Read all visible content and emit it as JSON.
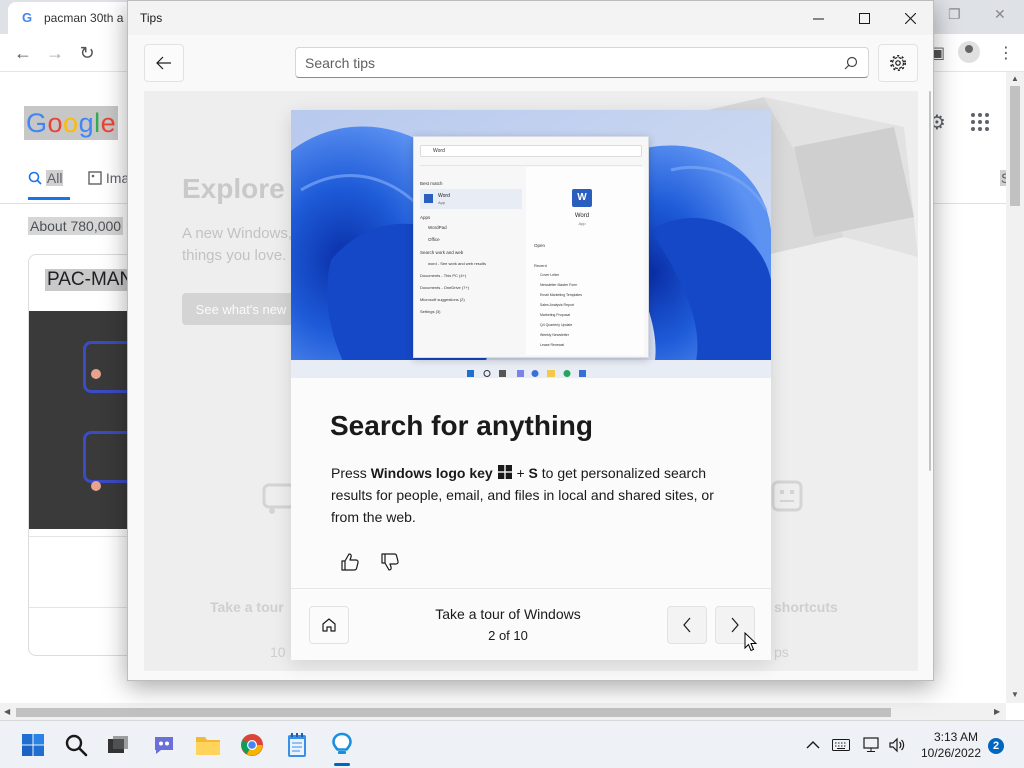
{
  "browser": {
    "tab_title": "pacman 30th an",
    "google_logo": [
      "G",
      "o",
      "o",
      "g",
      "l",
      "e"
    ],
    "search_tabs": [
      {
        "label": "All",
        "icon": "search-icon",
        "active": true
      },
      {
        "label": "Ima",
        "icon": "image-icon",
        "active": false
      }
    ],
    "right_tab_partial": "S",
    "result_stats": "About 780,000",
    "knowledge_card_title": "PAC-MAN"
  },
  "tips": {
    "window_title": "Tips",
    "search_placeholder": "Search tips",
    "background": {
      "heading": "Explore W",
      "subtext": "A new Windows, things you love.",
      "button": "See what's new",
      "tile_left": "Take a tour",
      "tile_right": "shortcuts",
      "tile_left_sub": "10",
      "tile_right_sub": "ps"
    },
    "card": {
      "heading": "Search for anything",
      "desc_prefix": "Press ",
      "desc_key": "Windows logo key",
      "desc_plus": " + ",
      "desc_s": "S",
      "desc_suffix": " to get personalized search results for people, email, and files in local and shared sites, or from the web.",
      "tour_title": "Take a tour of Windows",
      "page_indicator": "2 of 10"
    },
    "hero": {
      "search_query": "Word",
      "best_match": "Best match",
      "app_name": "Word",
      "app_sub": "App",
      "apps_label": "Apps",
      "apps": [
        "WordPad",
        "Office"
      ],
      "web_label": "Search work and web",
      "web_item": "word - See work and web results",
      "doc_items": [
        "Documents - This PC (4+)",
        "Documents - OneDrive (7+)",
        "Microsoft suggestions (2)",
        "Settings (3)"
      ],
      "preview_title": "Word",
      "preview_sub": "App",
      "preview_action": "Open",
      "recent_label": "Recent",
      "recent_items": [
        "Cover Letter",
        "Newsletter Master Form",
        "Email Marketing Templates",
        "Sales Analysis Report",
        "Marketing Proposal",
        "Q4 Quarterly Update",
        "Weekly Newsletter",
        "Lease Renewal"
      ]
    }
  },
  "taskbar": {
    "time": "3:13 AM",
    "date": "10/26/2022",
    "notification_count": "2",
    "apps": [
      "start-icon",
      "search-icon",
      "task-view-icon",
      "teams-chat-icon",
      "file-explorer-icon",
      "chrome-icon",
      "notepad-icon",
      "tips-icon"
    ]
  },
  "colors": {
    "accent": "#0067c0",
    "hero_blue": "#1e5bd8",
    "google_blue": "#4285f4",
    "google_red": "#ea4335",
    "google_yellow": "#fbbc05",
    "google_green": "#34a853"
  }
}
